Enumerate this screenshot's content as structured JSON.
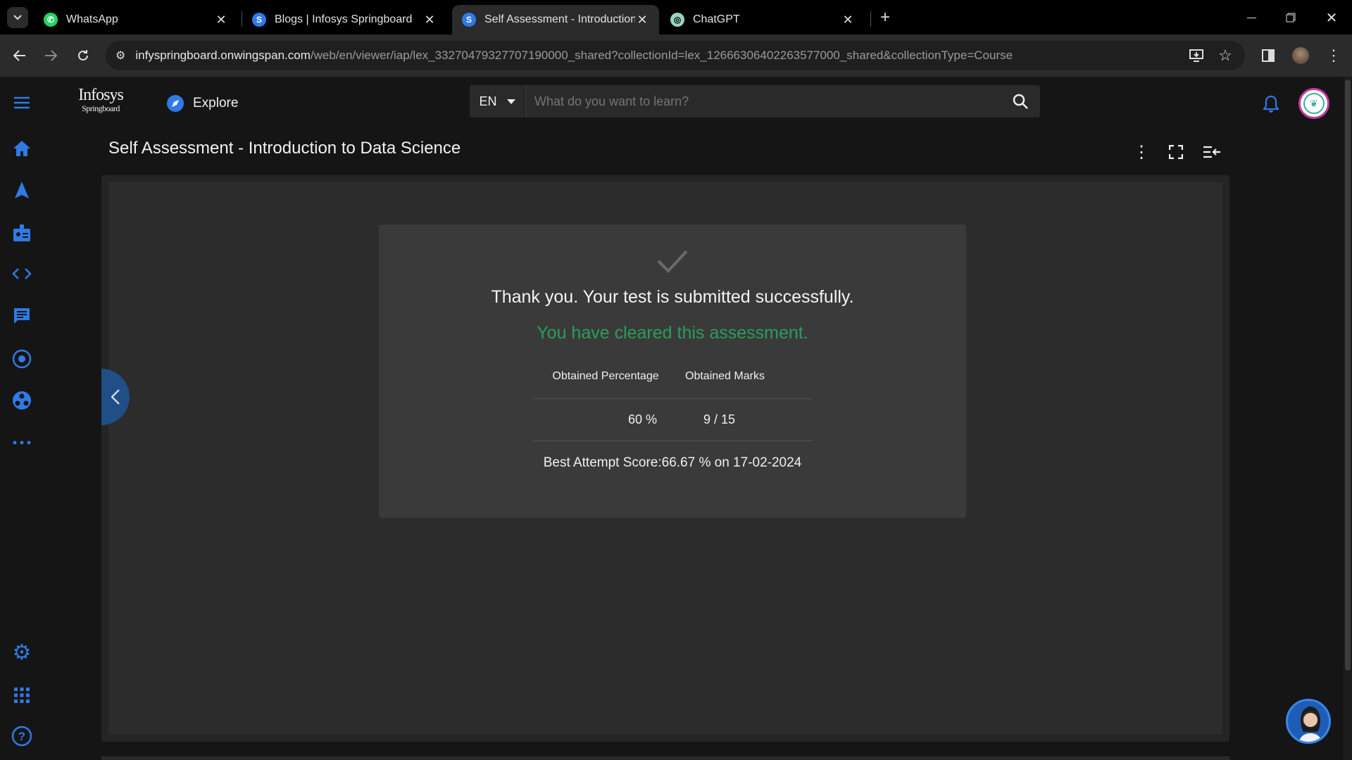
{
  "browser": {
    "tabs": [
      {
        "label": "WhatsApp",
        "active": false
      },
      {
        "label": "Blogs | Infosys Springboard",
        "active": false
      },
      {
        "label": "Self Assessment - Introduction t",
        "active": true
      },
      {
        "label": "ChatGPT",
        "active": false
      }
    ],
    "url_host": "infyspringboard.onwingspan.com",
    "url_path": "/web/en/viewer/iap/lex_33270479327707190000_shared?collectionId=lex_12666306402263577000_shared&collectionType=Course"
  },
  "header": {
    "logo_line1": "Infosys",
    "logo_line2": "Springboard",
    "explore_label": "Explore",
    "lang": "EN",
    "search_placeholder": "What do you want to learn?"
  },
  "page": {
    "title": "Self Assessment - Introduction to Data Science"
  },
  "result": {
    "message": "Thank you. Your test is submitted successfully.",
    "cleared": "You have cleared this assessment.",
    "col1_header": "Obtained Percentage",
    "col2_header": "Obtained Marks",
    "percentage": "60 %",
    "marks": "9 / 15",
    "best_attempt": "Best Attempt Score:66.67 % on 17-02-2024"
  },
  "colors": {
    "accent": "#2f7ae5",
    "success": "#2a9d5c"
  }
}
